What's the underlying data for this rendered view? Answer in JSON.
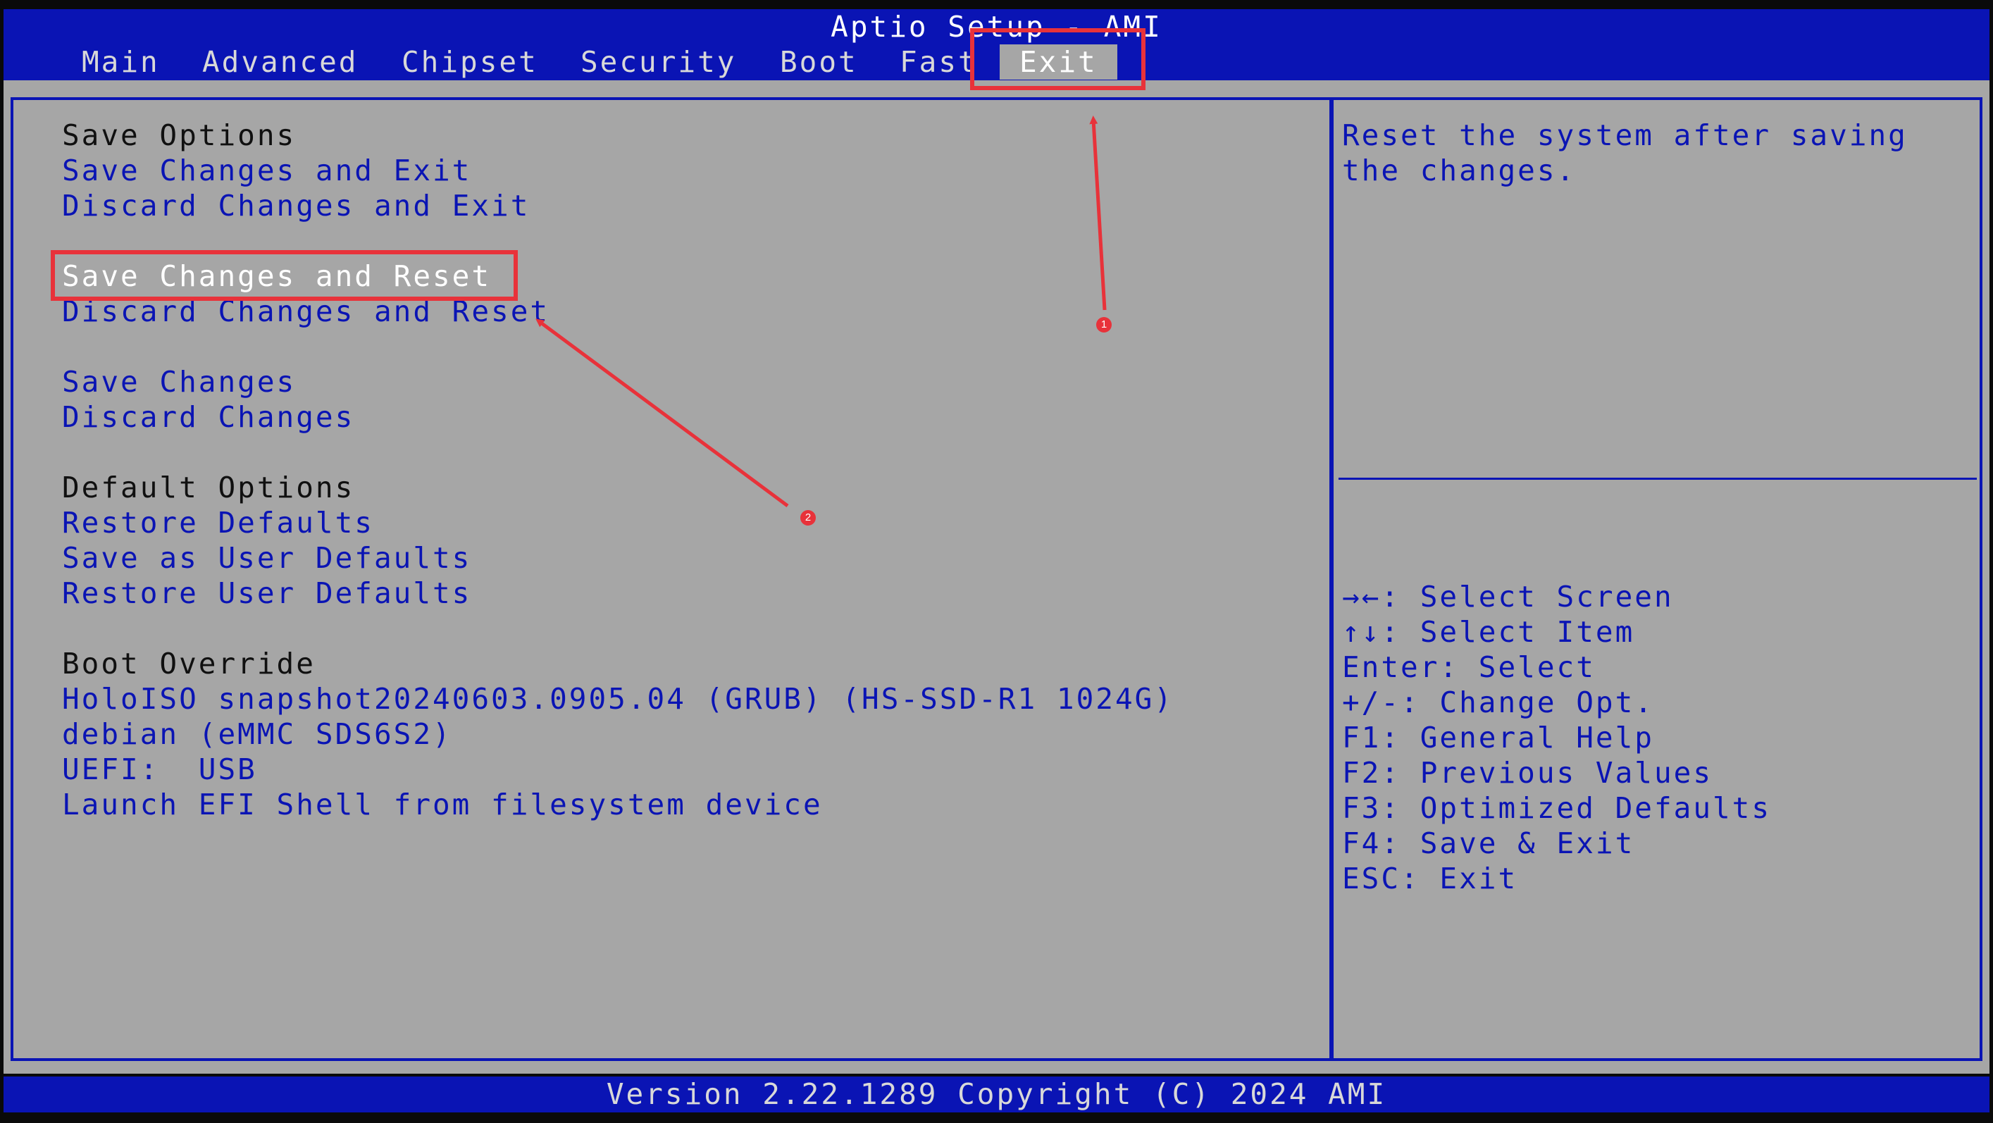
{
  "app": {
    "title": "Aptio Setup - AMI"
  },
  "tabs": [
    "Main",
    "Advanced",
    "Chipset",
    "Security",
    "Boot",
    "Fast",
    "Exit"
  ],
  "active_tab": "Exit",
  "menu": {
    "save_options_header": "Save Options",
    "save_changes_and_exit": "Save Changes and Exit",
    "discard_changes_and_exit": "Discard Changes and Exit",
    "save_changes_and_reset": "Save Changes and Reset",
    "discard_changes_and_reset": "Discard Changes and Reset",
    "save_changes": "Save Changes",
    "discard_changes": "Discard Changes",
    "default_options_header": "Default Options",
    "restore_defaults": "Restore Defaults",
    "save_as_user_defaults": "Save as User Defaults",
    "restore_user_defaults": "Restore User Defaults",
    "boot_override_header": "Boot Override",
    "boot_holoiso": "HoloISO snapshot20240603.0905.04 (GRUB) (HS-SSD-R1 1024G)",
    "boot_debian": "debian (eMMC SDS6S2)",
    "boot_uefi_usb": "UEFI:  USB",
    "boot_efi_shell": "Launch EFI Shell from filesystem device"
  },
  "selected_item": "Save Changes and Reset",
  "help": {
    "line1": "Reset the system after saving",
    "line2": "the changes."
  },
  "keys": [
    "→←: Select Screen",
    "↑↓: Select Item",
    "Enter: Select",
    "+/-: Change Opt.",
    "F1: General Help",
    "F2: Previous Values",
    "F3: Optimized Defaults",
    "F4: Save & Exit",
    "ESC: Exit"
  ],
  "footer": {
    "version": "Version 2.22.1289 Copyright (C) 2024 AMI"
  },
  "annotations": {
    "marker_1": "1",
    "marker_2": "2",
    "color": "#e8323a"
  },
  "colors": {
    "bios_blue": "#0a14b4",
    "panel_gray": "#a6a6a6",
    "highlight_text": "#ffffff"
  }
}
